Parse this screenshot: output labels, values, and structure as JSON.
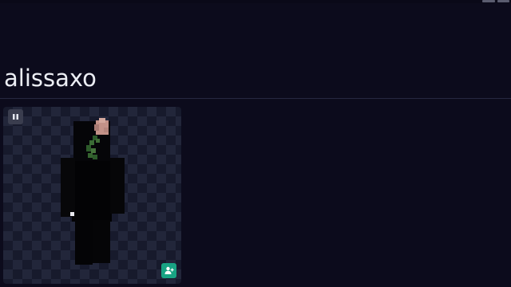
{
  "profile": {
    "username": "alissaxo"
  },
  "viewer": {
    "pause_icon": "pause-icon",
    "add_friend_icon": "user-plus-icon",
    "model": "player-skin-black-hood-with-pink-rose"
  },
  "colors": {
    "background": "#0c0b1c",
    "viewer_checker_dark": "#171a2c",
    "viewer_checker_light": "#22263a",
    "accent_button": "#18a383",
    "control_button": "#3a3d4e",
    "text": "#eceef4"
  }
}
